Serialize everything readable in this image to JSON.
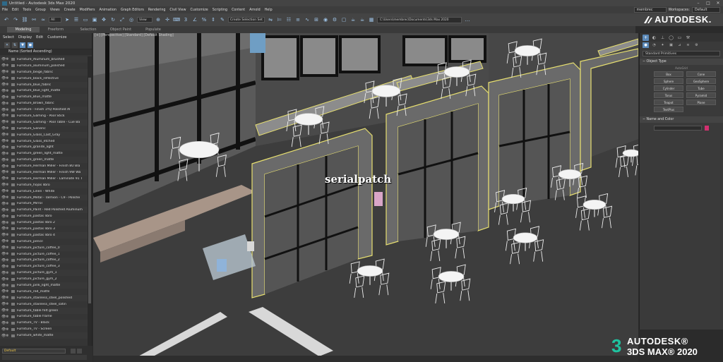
{
  "window": {
    "title": "Untitled - Autodesk 3ds Max 2020",
    "controls": [
      "–",
      "□",
      "✕"
    ]
  },
  "menu": {
    "items": [
      "File",
      "Edit",
      "Tools",
      "Group",
      "Views",
      "Create",
      "Modifiers",
      "Animation",
      "Graph Editors",
      "Rendering",
      "Civil View",
      "Customize",
      "Scripting",
      "Content",
      "Arnold",
      "Help"
    ],
    "user": "membrec",
    "workspace_label": "Workspaces:",
    "workspace_value": "Default"
  },
  "toolbar": {
    "filter": "All",
    "view": "View",
    "selection_set": "Create Selection Set",
    "path": "C:\\Users\\membrec\\Documents\\3ds Max 2020"
  },
  "ribbon": {
    "tabs": [
      "Modeling",
      "Freeform",
      "Selection",
      "Object Paint",
      "Populate"
    ]
  },
  "branding": {
    "top": "AUTODESK.",
    "bottom_line1": "AUTODESK®",
    "bottom_line2": "3DS MAX® 2020",
    "accent_color": "#1fc3a0"
  },
  "explorer": {
    "tabs": [
      "Select",
      "Display",
      "Edit",
      "Customize"
    ],
    "header": "Name (Sorted Ascending)",
    "items": [
      "Furniture_Aluminum_brushed",
      "Furniture_aluminum_polished",
      "Furniture_beige_fabric",
      "Furniture_black_reflective",
      "Furniture_blue_fabric",
      "Furniture_blue_light_matte",
      "Furniture_Blue_matte",
      "Furniture_Brown_fabric",
      "Furniture - Finish 1YQ Polished Al",
      "Furniture_Gaming - Pool Stick",
      "Furniture_Gaming - Pool Table - Cue Ba",
      "Furniture_Generic",
      "Furniture_Glass_Cast_Gray",
      "Furniture_Glass_etched",
      "Furniture_granite_light",
      "Furniture_green_light_matte",
      "Furniture_green_matte",
      "Furniture_Herman Miller - Finish 8U Bla",
      "Furniture_Herman Miller - Finish 9W Wa",
      "Furniture_Herman Miller - Laminate 91 T",
      "Furniture_hojas libro",
      "Furniture_Linen - White",
      "Furniture_Metal - Talmion - C9 - Polishe",
      "Furniture_Mirror",
      "Furniture_Paint - Red Polished Aluminum",
      "Furniture_pastas libro",
      "Furniture_pastas libro 2",
      "Furniture_pastas libro 3",
      "Furniture_pastas libro 4",
      "Furniture_pencil",
      "Furniture_picture_coffee_0",
      "Furniture_picture_coffee_1",
      "Furniture_picture_coffee_2",
      "Furniture_picture_coffee_3",
      "Furniture_picture_gym_1",
      "Furniture_picture_gym_2",
      "Furniture_pink_light_matte",
      "Furniture_red_matte",
      "Furniture_stainless_steel_polished",
      "Furniture_stainless_steel_satin",
      "Furniture_table felt green",
      "Furniture_table frame",
      "Furniture_TV - Black",
      "Furniture_TV - Screen",
      "Furniture_white_matte"
    ],
    "layer": "Default"
  },
  "viewport": {
    "label": "[+] [Perspective] [Standard] [Default Shading]",
    "watermark": "serialpatch"
  },
  "command_panel": {
    "dropdown": "Standard Primitives",
    "object_type_header": "Object Type",
    "autogrid": "AutoGrid",
    "buttons": [
      "Box",
      "Cone",
      "Sphere",
      "GeoSphere",
      "Cylinder",
      "Tube",
      "Torus",
      "Pyramid",
      "Teapot",
      "Plane",
      "TextPlus"
    ],
    "name_color_header": "Name and Color",
    "color_swatch": "#d1306f"
  }
}
